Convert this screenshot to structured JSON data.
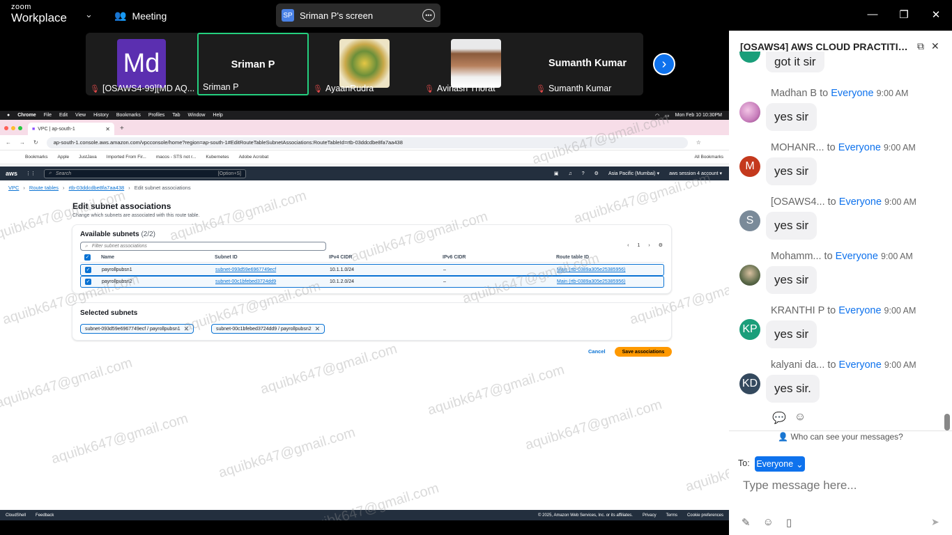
{
  "zoom": {
    "logo_top": "zoom",
    "logo_bottom": "Workplace",
    "meeting_label": "Meeting",
    "share_badge": "SP",
    "share_title": "Sriman P's screen",
    "minimize": "—",
    "restore": "❐",
    "close": "✕"
  },
  "participants": [
    {
      "initials": "Md",
      "name": "[OSAWS4-99][MD AQ..."
    },
    {
      "big": "Sriman P",
      "name": "Sriman P"
    },
    {
      "name": "AyaanRudra"
    },
    {
      "name": "Avinash Thorat"
    },
    {
      "big": "Sumanth Kumar",
      "name": "Sumanth Kumar"
    }
  ],
  "browser": {
    "mac_menu": [
      "Chrome",
      "File",
      "Edit",
      "View",
      "History",
      "Bookmarks",
      "Profiles",
      "Tab",
      "Window",
      "Help"
    ],
    "mac_clock": "Mon Feb 10  10:30PM",
    "tab_title": "VPC | ap-south-1",
    "url": "ap-south-1.console.aws.amazon.com/vpcconsole/home?region=ap-south-1#EditRouteTableSubnetAssociations:RouteTableId=rtb-03ddcdbe8fa7aa438",
    "bookmarks": [
      "Bookmarks",
      "Apple",
      "JustJava",
      "Imported From Fir...",
      "macos - STS not r...",
      "Kubernetes",
      "Adobe Acrobat"
    ],
    "all_bookmarks": "All Bookmarks"
  },
  "aws": {
    "logo": "aws",
    "search_placeholder": "Search",
    "search_shortcut": "[Option+S]",
    "region": "Asia Pacific (Mumbai) ▾",
    "account": "aws session 4 account ▾",
    "breadcrumb": [
      "VPC",
      "Route tables",
      "rtb-03ddcdbe8fa7aa438",
      "Edit subnet associations"
    ],
    "page_title": "Edit subnet associations",
    "page_subtitle": "Change which subnets are associated with this route table.",
    "available_title": "Available subnets",
    "available_count": "(2/2)",
    "filter_placeholder": "Filter subnet associations",
    "page_number": "1",
    "columns": [
      "Name",
      "Subnet ID",
      "IPv4 CIDR",
      "IPv6 CIDR",
      "Route table ID"
    ],
    "rows": [
      {
        "name": "payrollpubsn1",
        "subnet_id": "subnet-093d59e6967749ecf",
        "ipv4": "10.1.1.0/24",
        "ipv6": "–",
        "route_table": "Main (rtb-0389a305e25385956)"
      },
      {
        "name": "payrollpubsn2",
        "subnet_id": "subnet-00c1bfebed3724dd9",
        "ipv4": "10.1.2.0/24",
        "ipv6": "–",
        "route_table": "Main (rtb-0389a305e25385956)"
      }
    ],
    "selected_title": "Selected subnets",
    "tokens": [
      "subnet-093d59e6967749ecf / payrollpubsn1",
      "subnet-00c1bfebed3724dd9 / payrollpubsn2"
    ],
    "cancel": "Cancel",
    "save": "Save associations",
    "footer_left": [
      "CloudShell",
      "Feedback"
    ],
    "footer_copy": "© 2025, Amazon Web Services, Inc. or its affiliates.",
    "footer_right": [
      "Privacy",
      "Terms",
      "Cookie preferences"
    ]
  },
  "watermark": "aquibk647@gmail.com",
  "chat": {
    "title": "[OSAWS4] AWS CLOUD PRACTITION...",
    "partial_message": "got it sir",
    "to_word": "to",
    "everyone": "Everyone",
    "messages": [
      {
        "sender": "Madhan B",
        "time": "9:00 AM",
        "text": "yes sir",
        "avatar": "",
        "avatar_color": "#c77dbb"
      },
      {
        "sender": "MOHANR...",
        "time": "9:00 AM",
        "text": "yes sir",
        "avatar": "M",
        "avatar_color": "#c4391d"
      },
      {
        "sender": "[OSAWS4...",
        "time": "9:00 AM",
        "text": "yes sir",
        "avatar": "S",
        "avatar_color": "#7a8a99"
      },
      {
        "sender": "Mohamm...",
        "time": "9:00 AM",
        "text": "yes sir",
        "avatar": "",
        "avatar_color": "#5d6b4a"
      },
      {
        "sender": "KRANTHI P",
        "time": "9:00 AM",
        "text": "yes sir",
        "avatar": "KP",
        "avatar_color": "#1a9e7a"
      },
      {
        "sender": "kalyani da...",
        "time": "9:00 AM",
        "text": "yes sir.",
        "avatar": "KD",
        "avatar_color": "#34495e"
      }
    ],
    "who_can_see": "Who can see your messages?",
    "to_label": "To:",
    "to_value": "Everyone",
    "input_placeholder": "Type message here..."
  },
  "colors": {
    "zoom_blue": "#0e72ed",
    "aws_orange": "#ff9900",
    "aws_link": "#0972d3",
    "active_tile_border": "#24d07f"
  }
}
